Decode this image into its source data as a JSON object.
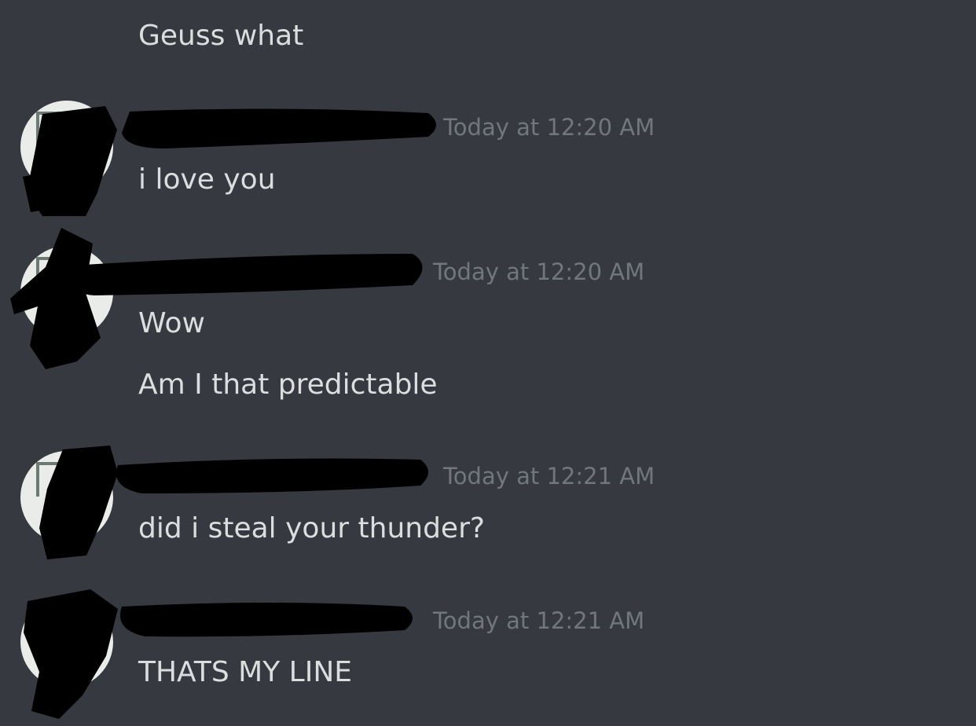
{
  "messages": [
    {
      "content": [
        "Geuss what"
      ]
    },
    {
      "author": "",
      "timestamp": "Today at 12:20 AM",
      "content": [
        "i love you"
      ]
    },
    {
      "author": "",
      "timestamp": "Today at 12:20 AM",
      "content": [
        "Wow",
        "Am I that predictable"
      ]
    },
    {
      "author": "",
      "timestamp": "Today at 12:21 AM",
      "content": [
        "did i steal your thunder?"
      ]
    },
    {
      "author": "",
      "timestamp": "Today at 12:21 AM",
      "content": [
        "THATS MY LINE"
      ]
    }
  ],
  "colors": {
    "background": "#36393f",
    "message_text": "#dcddde",
    "timestamp_text": "#72767d",
    "redaction": "#000000"
  }
}
